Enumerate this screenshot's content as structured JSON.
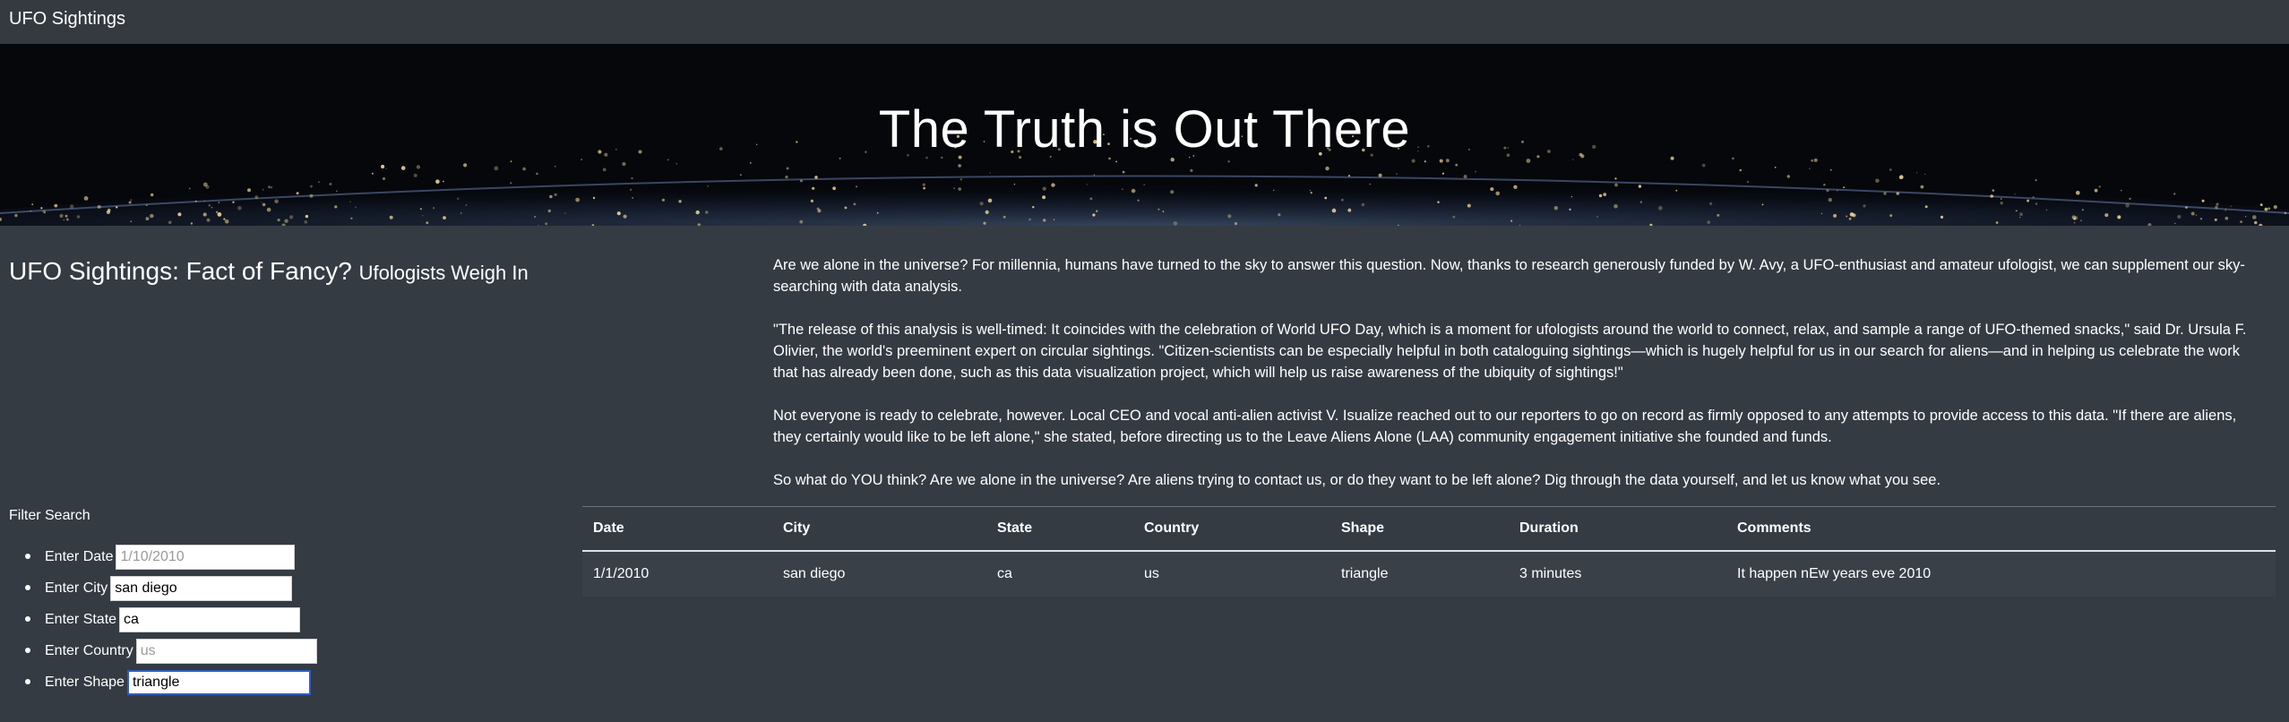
{
  "navbar": {
    "brand": "UFO Sightings"
  },
  "hero": {
    "title": "The Truth is Out There"
  },
  "intro": {
    "heading": "UFO Sightings: Fact of Fancy?",
    "subheading": "Ufologists Weigh In"
  },
  "article": {
    "paragraphs": [
      "Are we alone in the universe? For millennia, humans have turned to the sky to answer this question. Now, thanks to research generously funded by W. Avy, a UFO-enthusiast and amateur ufologist, we can supplement our sky-searching with data analysis.",
      "\"The release of this analysis is well-timed: It coincides with the celebration of World UFO Day, which is a moment for ufologists around the world to connect, relax, and sample a range of UFO-themed snacks,\" said Dr. Ursula F. Olivier, the world's preeminent expert on circular sightings. \"Citizen-scientists can be especially helpful in both cataloguing sightings—which is hugely helpful for us in our search for aliens—and in helping us celebrate the work that has already been done, such as this data visualization project, which will help us raise awareness of the ubiquity of sightings!\"",
      "Not everyone is ready to celebrate, however. Local CEO and vocal anti-alien activist V. Isualize reached out to our reporters to go on record as firmly opposed to any attempts to provide access to this data. \"If there are aliens, they certainly would like to be left alone,\" she stated, before directing us to the Leave Aliens Alone (LAA) community engagement initiative she founded and funds.",
      "So what do YOU think? Are we alone in the universe? Are aliens trying to contact us, or do they want to be left alone? Dig through the data yourself, and let us know what you see."
    ]
  },
  "filters": {
    "title": "Filter Search",
    "date": {
      "label": "Enter Date",
      "value": "",
      "placeholder": "1/10/2010"
    },
    "city": {
      "label": "Enter City",
      "value": "san diego",
      "placeholder": ""
    },
    "state": {
      "label": "Enter State",
      "value": "ca",
      "placeholder": ""
    },
    "country": {
      "label": "Enter Country",
      "value": "",
      "placeholder": "us"
    },
    "shape": {
      "label": "Enter Shape",
      "value": "triangle",
      "placeholder": ""
    }
  },
  "table": {
    "headers": [
      "Date",
      "City",
      "State",
      "Country",
      "Shape",
      "Duration",
      "Comments"
    ],
    "rows": [
      [
        "1/1/2010",
        "san diego",
        "ca",
        "us",
        "triangle",
        "3 minutes",
        "It happen nEw years eve 2010"
      ]
    ]
  },
  "colors": {
    "background": "#353b42",
    "navbar": "#343a40",
    "focus_border": "#2f5eb8"
  }
}
